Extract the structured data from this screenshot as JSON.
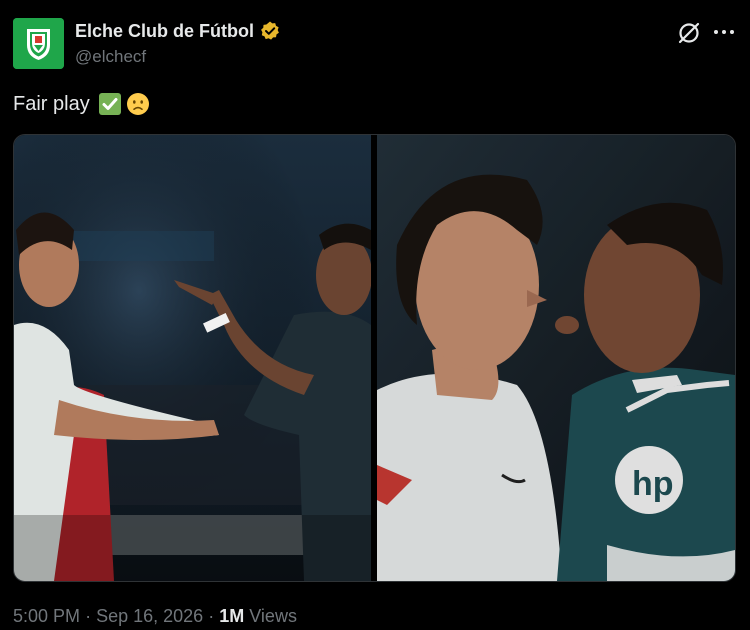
{
  "account": {
    "display_name": "Elche Club de Fútbol",
    "handle": "@elchecf",
    "verified": true,
    "avatar_icon": "elche-crest-icon",
    "avatar_color": "#1fa64a"
  },
  "header_actions": {
    "grok_icon": "grok-slash-circle-icon",
    "more_icon": "more-horizontal-icon"
  },
  "post": {
    "text": "Fair play",
    "emojis": [
      "check-mark-button-emoji",
      "frowning-face-emoji"
    ]
  },
  "media": {
    "count": 2,
    "photos": [
      {
        "name": "photo-1",
        "description_icon": "players-arguing-pointing-photo"
      },
      {
        "name": "photo-2",
        "description_icon": "players-face-to-face-photo"
      }
    ]
  },
  "footer": {
    "time": "5:00 PM",
    "separator": "·",
    "date": "Sep 16, 2026",
    "views_count": "1M",
    "views_label": "Views"
  },
  "colors": {
    "background": "#000000",
    "primary_text": "#e7e9ea",
    "secondary_text": "#71767b",
    "verified_badge": "#e8b72c",
    "elche_green": "#1fa64a"
  }
}
